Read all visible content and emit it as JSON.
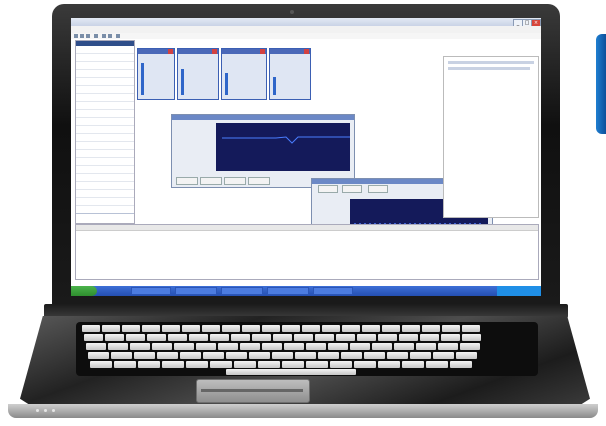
{
  "app": {
    "title": "",
    "window_buttons": [
      "_",
      "□",
      "×"
    ]
  },
  "menu": [],
  "toolbar_icons": [
    "new-icon",
    "open-icon",
    "save-icon",
    "print-icon",
    "run-icon",
    "stop-icon",
    "help-icon"
  ],
  "devices": [
    {
      "name": "",
      "voltage": "",
      "value": ""
    },
    {
      "name": "",
      "voltage": "",
      "value": ""
    },
    {
      "name": "",
      "voltage": "",
      "value": ""
    },
    {
      "name": "",
      "voltage": "",
      "value": ""
    }
  ],
  "chart_windows": [
    {
      "title": "",
      "buttons": [
        "",
        "",
        "",
        ""
      ]
    },
    {
      "title": "",
      "fields": [
        "",
        "",
        "",
        ""
      ],
      "buttons": [
        "",
        ""
      ]
    }
  ],
  "bottom_panel": {
    "header": ""
  },
  "taskbar": {
    "start_label": "",
    "tasks": [
      "",
      "",
      "",
      "",
      ""
    ],
    "clock": ""
  },
  "colors": {
    "accent": "#3b5fb3",
    "plot_background": "#141a5a",
    "taskbar": "#244fb2",
    "start_button": "#2e8e2e",
    "side_box": "#1f7fd1"
  }
}
